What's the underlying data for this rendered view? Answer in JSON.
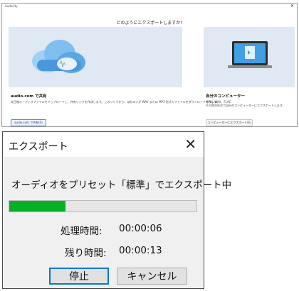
{
  "export_choice": {
    "app_title": "Audacity",
    "heading": "どのようにエクスポートしますか?",
    "share": {
      "title": "audio.com で共有",
      "description": "未圧縮オーディオファイルをアップロードし、共有リンクを作成します。このリンクから、ほかの人が WAV または MP3 形式でファイルをダウンロードできます。",
      "button_label": "audio.com で共有(S)"
    },
    "computer": {
      "title": "自分のコンピューター",
      "description_line1": "MP3、WAV、FLAC",
      "description_line2": "その他の形式で自分のコンピューターにエクスポートします。",
      "button_label": "コンピューターにエクスポート(E)"
    }
  },
  "export_dialog": {
    "title": "エクスポート",
    "message": "オーディオをプリセット「標準」でエクスポート中",
    "progress_fraction": 0.3,
    "progress_color": "#06b025",
    "elapsed_label": "処理時間:",
    "elapsed_value": "00:00:06",
    "remaining_label": "残り時間:",
    "remaining_value": "00:00:13",
    "stop_label": "停止",
    "cancel_label": "キャンセル",
    "accent_color": "#0078d7"
  }
}
